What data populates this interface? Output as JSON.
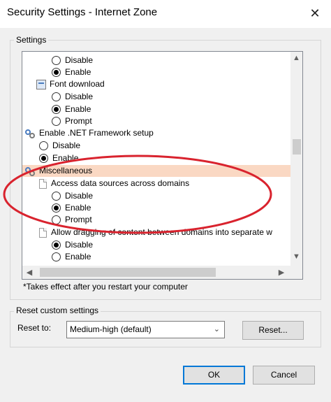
{
  "window": {
    "title": "Security Settings - Internet Zone",
    "close_glyph": "✕"
  },
  "settings": {
    "group_label": "Settings",
    "rows": [
      {
        "kind": "radio",
        "label": "Disable",
        "checked": false
      },
      {
        "kind": "radio",
        "label": "Enable",
        "checked": true
      },
      {
        "kind": "header",
        "icon": "font-icon",
        "label": "Font download"
      },
      {
        "kind": "radio",
        "label": "Disable",
        "checked": false
      },
      {
        "kind": "radio",
        "label": "Enable",
        "checked": true
      },
      {
        "kind": "radio",
        "label": "Prompt",
        "checked": false
      },
      {
        "kind": "header",
        "icon": "gear-icon",
        "label": "Enable .NET Framework setup"
      },
      {
        "kind": "radio",
        "label": "Disable",
        "checked": false
      },
      {
        "kind": "radio",
        "label": "Enable",
        "checked": true
      },
      {
        "kind": "category",
        "icon": "gear-icon",
        "label": "Miscellaneous",
        "highlight": true
      },
      {
        "kind": "header",
        "icon": "page-icon",
        "label": "Access data sources across domains"
      },
      {
        "kind": "radio",
        "label": "Disable",
        "checked": false
      },
      {
        "kind": "radio",
        "label": "Enable",
        "checked": true
      },
      {
        "kind": "radio",
        "label": "Prompt",
        "checked": false
      },
      {
        "kind": "header",
        "icon": "page-icon",
        "label": "Allow dragging of content between domains into separate w"
      },
      {
        "kind": "radio",
        "label": "Disable",
        "checked": true
      },
      {
        "kind": "radio",
        "label": "Enable",
        "checked": false
      }
    ],
    "note": "*Takes effect after you restart your computer"
  },
  "reset": {
    "group_label": "Reset custom settings",
    "label": "Reset to:",
    "selected": "Medium-high (default)",
    "button": "Reset..."
  },
  "footer": {
    "ok": "OK",
    "cancel": "Cancel"
  },
  "annotation": {
    "color": "#d9232e"
  }
}
